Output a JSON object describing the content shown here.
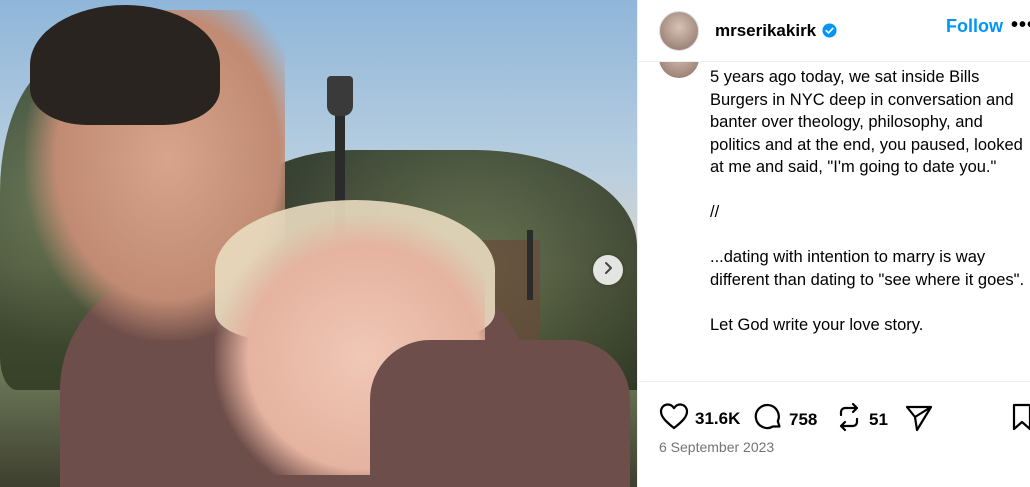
{
  "post": {
    "username": "mrserikakirk",
    "follow_label": "Follow",
    "more_label": "•••",
    "caption": "5 years ago today, we sat inside Bills Burgers in NYC deep in conversation and banter over theology, philosophy, and politics and at the end, you paused, looked at me and said, \"I'm going to date you.\"\n\n//\n\n...dating with intention to marry is way different than dating to \"see where it goes\".\n\nLet God write your love story.",
    "likes": "31.6K",
    "comments": "758",
    "reposts": "51",
    "date": "6 September 2023"
  },
  "icons": {
    "verified": "verified-badge-icon",
    "next": "chevron-right-icon",
    "like": "heart-icon",
    "comment": "comment-icon",
    "repost": "repost-icon",
    "share": "send-icon",
    "save": "bookmark-icon"
  },
  "colors": {
    "accent": "#0095f6",
    "muted": "#737373"
  }
}
